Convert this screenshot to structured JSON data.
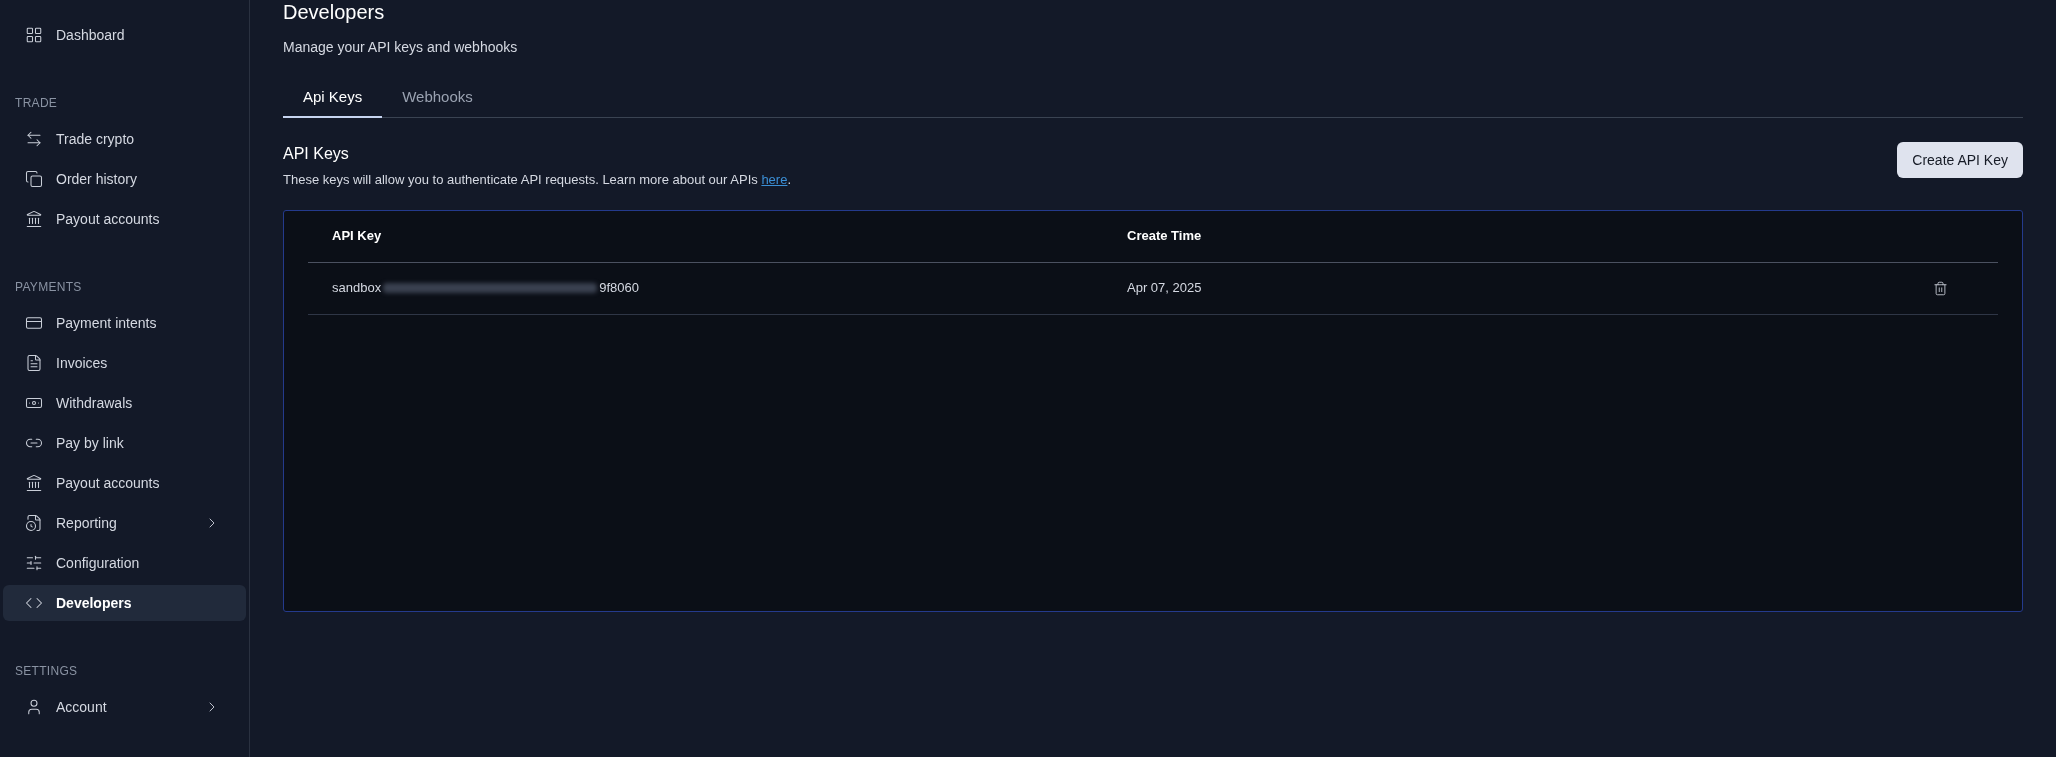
{
  "sidebar": {
    "sections": [
      {
        "items": [
          {
            "label": "Dashboard",
            "kind": "dashboard",
            "selected": false,
            "expandable": false
          }
        ]
      },
      {
        "title": "TRADE",
        "items": [
          {
            "label": "Trade crypto",
            "kind": "swap",
            "selected": false,
            "expandable": false
          },
          {
            "label": "Order history",
            "kind": "copies",
            "selected": false,
            "expandable": false
          },
          {
            "label": "Payout accounts",
            "kind": "bank",
            "selected": false,
            "expandable": false
          }
        ]
      },
      {
        "title": "PAYMENTS",
        "items": [
          {
            "label": "Payment intents",
            "kind": "card",
            "selected": false,
            "expandable": false
          },
          {
            "label": "Invoices",
            "kind": "file",
            "selected": false,
            "expandable": false
          },
          {
            "label": "Withdrawals",
            "kind": "withdraw",
            "selected": false,
            "expandable": false
          },
          {
            "label": "Pay by link",
            "kind": "link",
            "selected": false,
            "expandable": false
          },
          {
            "label": "Payout accounts",
            "kind": "bank",
            "selected": false,
            "expandable": false
          },
          {
            "label": "Reporting",
            "kind": "report",
            "selected": false,
            "expandable": true
          },
          {
            "label": "Configuration",
            "kind": "sliders",
            "selected": false,
            "expandable": false
          },
          {
            "label": "Developers",
            "kind": "code",
            "selected": true,
            "expandable": false
          }
        ]
      },
      {
        "title": "SETTINGS",
        "items": [
          {
            "label": "Account",
            "kind": "user",
            "selected": false,
            "expandable": true
          }
        ]
      }
    ]
  },
  "page": {
    "title": "Developers",
    "subtitle": "Manage your API keys and webhooks"
  },
  "tabs": [
    {
      "label": "Api Keys",
      "selected": true
    },
    {
      "label": "Webhooks",
      "selected": false
    }
  ],
  "api_keys": {
    "title": "API Keys",
    "description": "These keys will allow you to authenticate API requests. Learn more about our APIs ",
    "link": "here",
    "after_link": ".",
    "create_button": "Create API Key"
  },
  "table": {
    "columns": [
      "API Key",
      "Create Time"
    ],
    "rows": [
      {
        "key_prefix": "sandbox",
        "key_suffix": "9f8060",
        "created": "Apr 07, 2025"
      }
    ]
  }
}
